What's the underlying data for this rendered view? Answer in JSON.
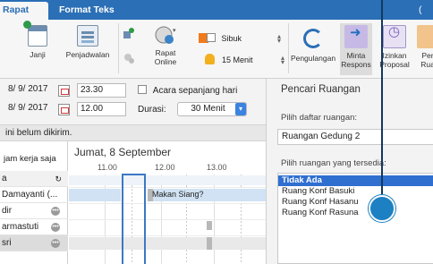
{
  "tabs": {
    "meeting": "Rapat",
    "format": "Format Teks",
    "extra": "("
  },
  "ribbon": {
    "appointment": "Janji",
    "scheduler": "Penjadwalan",
    "online_meeting_line1": "Rapat",
    "online_meeting_line2": "Online",
    "show_as": "Sibuk",
    "reminder": "15 Menit",
    "recurrence": "Pengulangan",
    "request_responses_line1": "Minta",
    "request_responses_line2": "Respons",
    "allow_proposals_line1": "Izinkan",
    "allow_proposals_line2": "Proposal",
    "room_finder_line1": "Per",
    "room_finder_line2": "Rua"
  },
  "form": {
    "start_date": "8/ 9/ 2017",
    "start_time": "23.30",
    "end_date": "8/ 9/ 2017",
    "end_time": "12.00",
    "all_day_label": "Acara sepanjang hari",
    "duration_label": "Durasi:",
    "duration_value": "30 Menit",
    "not_sent_msg": "ini belum dikirim."
  },
  "scheduler": {
    "date_title": "Jumat, 8 September",
    "work_hours_label": "jam kerja saja",
    "hours": [
      "11.00",
      "12.00",
      "13.00"
    ],
    "header_cell": "a",
    "attendees": [
      "Damayanti (...",
      "dir",
      "armastuti",
      "sri"
    ],
    "lunch_label": "Makan Siang?"
  },
  "room_finder": {
    "title": "Pencari Ruangan",
    "list_label": "Pilih daftar ruangan:",
    "list_value": "Ruangan Gedung 2",
    "available_label": "Pilih ruangan yang tersedia:",
    "rooms": [
      "Tidak Ada",
      "Ruang Konf Basuki",
      "Ruang Konf Hasanu",
      "Ruang Konf Rasuna"
    ]
  },
  "colors": {
    "accent": "#2b6fb6",
    "selection": "#2f6fd0",
    "busy": "#f07b1c"
  }
}
